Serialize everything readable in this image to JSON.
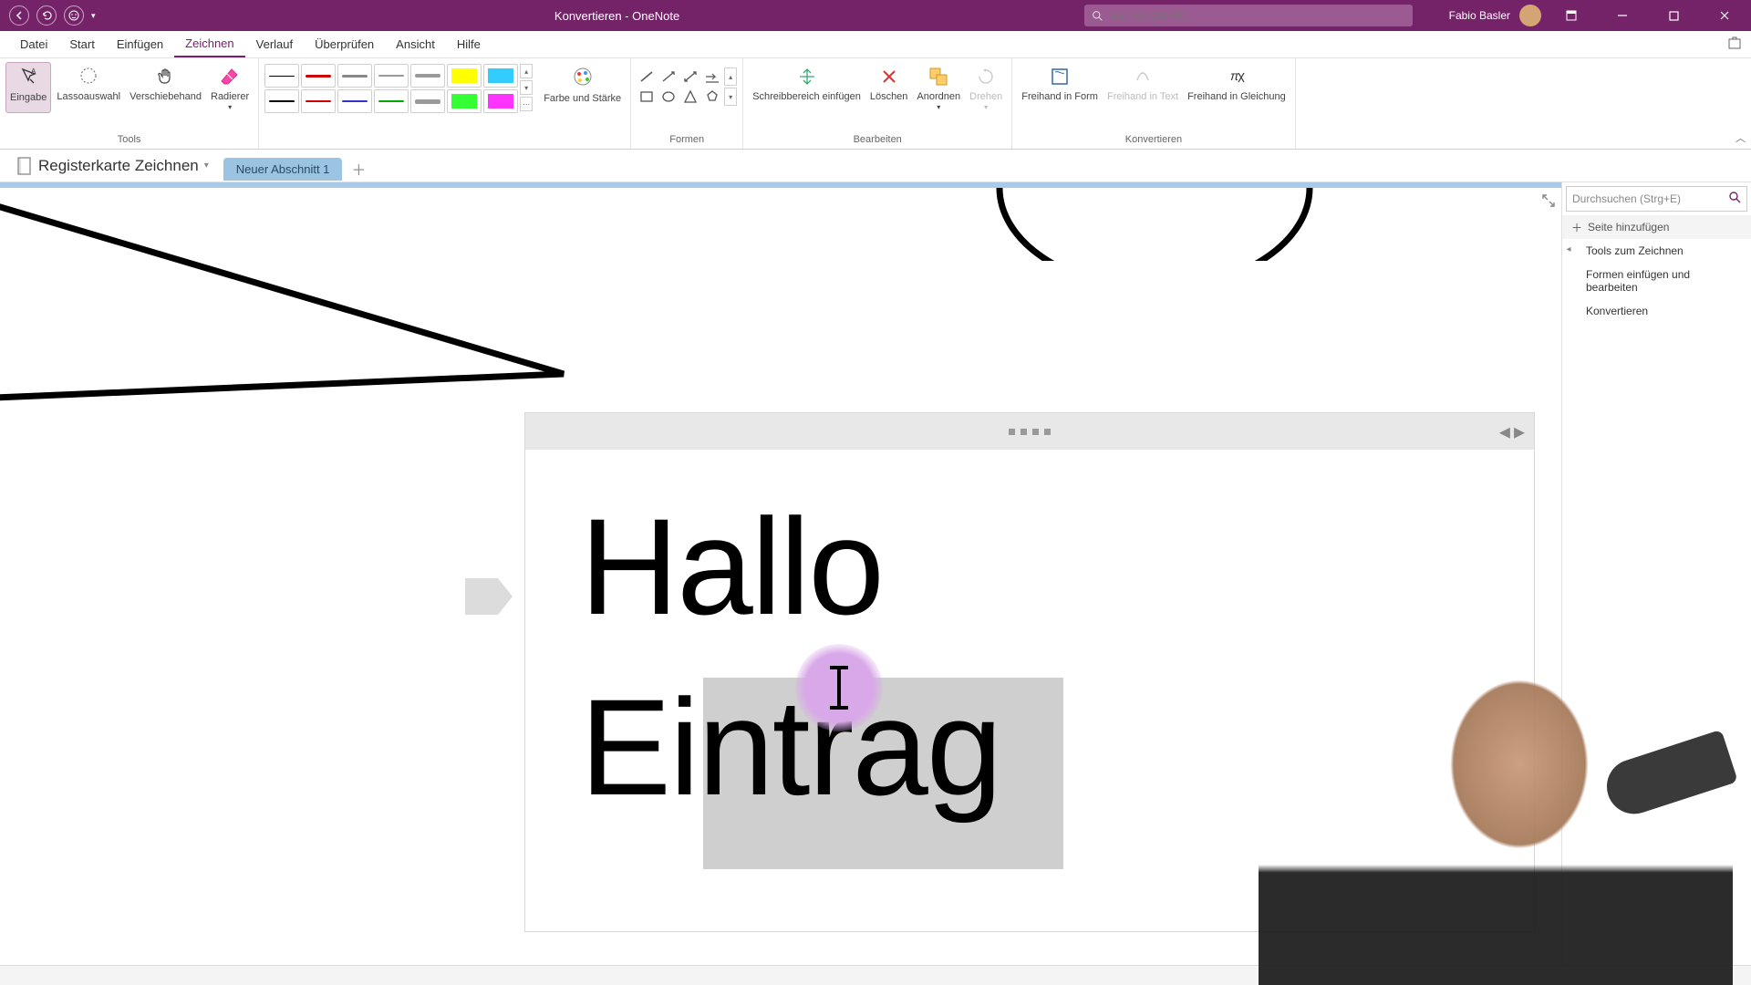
{
  "title": "Konvertieren  -  OneNote",
  "search_placeholder": "Suchen (Alt+M)",
  "user_name": "Fabio Basler",
  "menu": {
    "datei": "Datei",
    "start": "Start",
    "einfuegen": "Einfügen",
    "zeichnen": "Zeichnen",
    "verlauf": "Verlauf",
    "ueberpruefen": "Überprüfen",
    "ansicht": "Ansicht",
    "hilfe": "Hilfe"
  },
  "ribbon": {
    "tools": {
      "eingabe": "Eingabe",
      "lasso": "Lassoauswahl",
      "hand": "Verschiebehand",
      "radierer": "Radierer",
      "label": "Tools"
    },
    "pens": {
      "farbe": "Farbe und Stärke"
    },
    "formen": {
      "label": "Formen"
    },
    "bearbeiten": {
      "space": "Schreibbereich einfügen",
      "loeschen": "Löschen",
      "anordnen": "Anordnen",
      "drehen": "Drehen",
      "label": "Bearbeiten"
    },
    "konvertieren": {
      "form": "Freihand in Form",
      "text": "Freihand in Text",
      "gleichung": "Freihand in Gleichung",
      "label": "Konvertieren"
    }
  },
  "notebook": {
    "name": "Registerkarte Zeichnen",
    "section": "Neuer Abschnitt 1"
  },
  "side": {
    "search": "Durchsuchen (Strg+E)",
    "addpage": "Seite hinzufügen",
    "items": [
      "Tools zum Zeichnen",
      "Formen einfügen und bearbeiten",
      "Konvertieren"
    ]
  },
  "note": {
    "line1": "Hallo",
    "line2": "Eintrag"
  }
}
